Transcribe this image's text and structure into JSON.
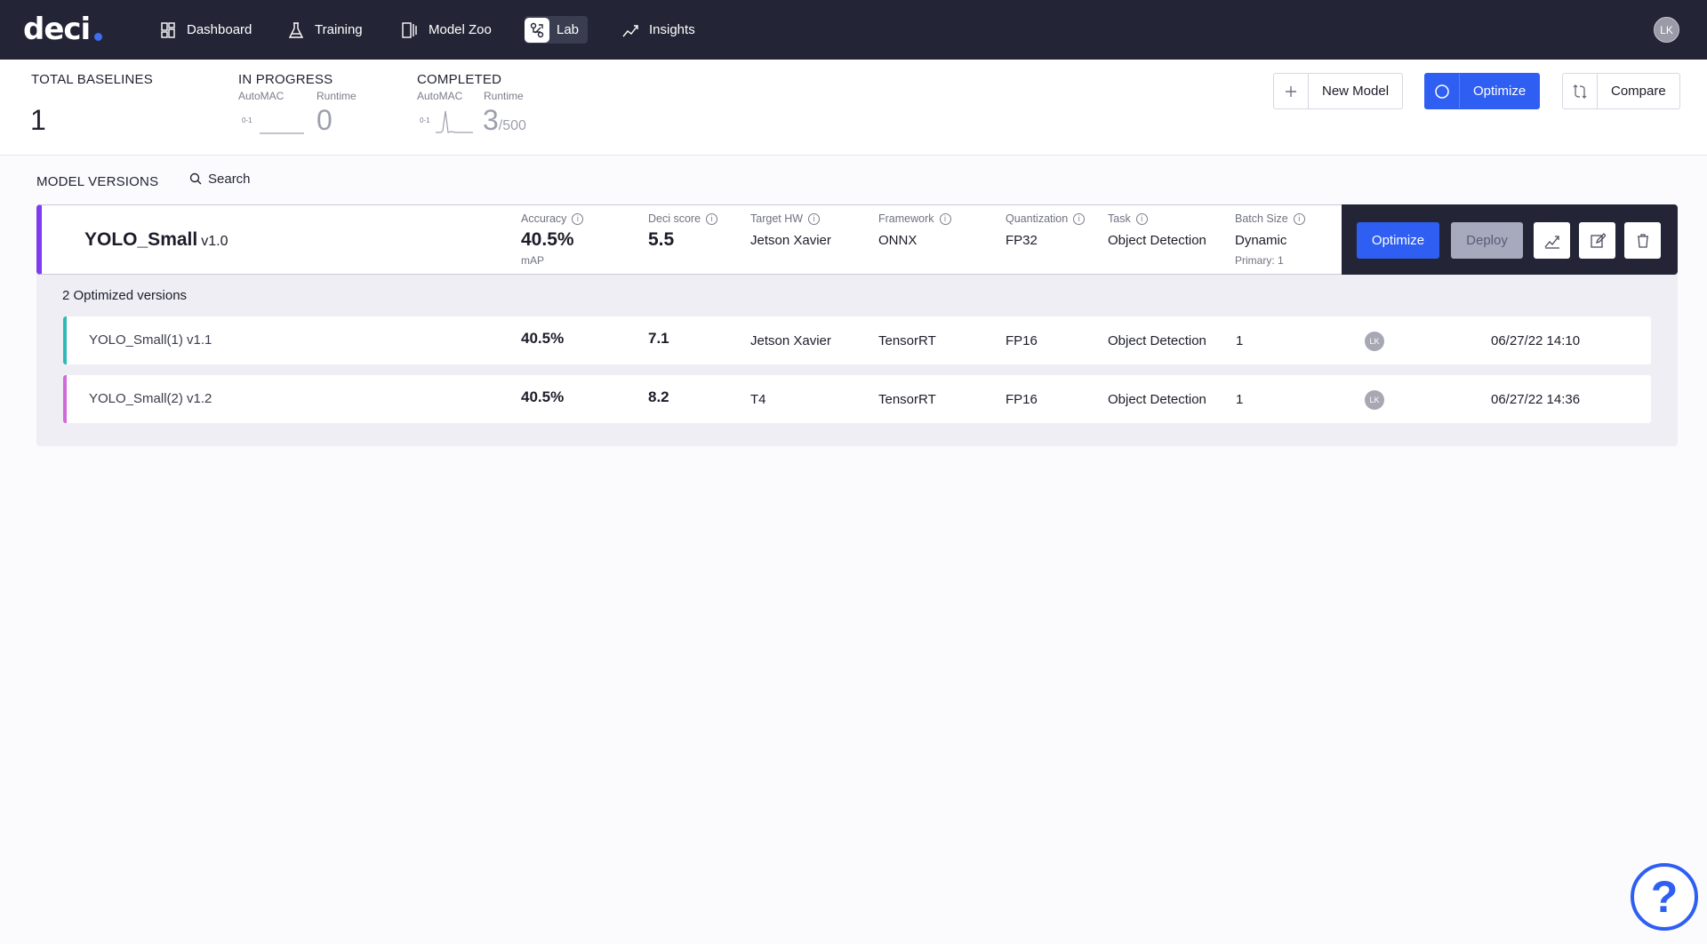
{
  "nav": {
    "logo": "deci",
    "items": [
      {
        "label": "Dashboard",
        "icon": "dashboard-icon"
      },
      {
        "label": "Training",
        "icon": "flask-icon"
      },
      {
        "label": "Model Zoo",
        "icon": "model-zoo-icon"
      },
      {
        "label": "Lab",
        "icon": "lab-icon"
      },
      {
        "label": "Insights",
        "icon": "insights-icon"
      }
    ],
    "active": "Lab",
    "avatar": "LK"
  },
  "stats": {
    "total_baselines": {
      "title": "TOTAL BASELINES",
      "value": "1"
    },
    "in_progress": {
      "title": "IN PROGRESS",
      "automac_label": "AutoMAC",
      "runtime_label": "Runtime",
      "spark_label": "0-1",
      "runtime_value": "0"
    },
    "completed": {
      "title": "COMPLETED",
      "automac_label": "AutoMAC",
      "runtime_label": "Runtime",
      "spark_label": "0-1",
      "runtime_value": "3",
      "runtime_total": "/500"
    }
  },
  "actions": {
    "new_model": "New Model",
    "optimize": "Optimize",
    "compare": "Compare"
  },
  "model_versions": {
    "title": "MODEL VERSIONS",
    "search": "Search"
  },
  "baseline": {
    "name": "YOLO_Small",
    "version": "v1.0",
    "columns": {
      "accuracy": "Accuracy",
      "deci_score": "Deci score",
      "target_hw": "Target HW",
      "framework": "Framework",
      "quantization": "Quantization",
      "task": "Task",
      "batch_size": "Batch Size"
    },
    "accuracy": "40.5%",
    "accuracy_metric": "mAP",
    "deci_score": "5.5",
    "target_hw": "Jetson Xavier",
    "framework": "ONNX",
    "quantization": "FP32",
    "task": "Object Detection",
    "batch_size": "Dynamic",
    "batch_primary": "Primary: 1",
    "optimize_label": "Optimize",
    "deploy_label": "Deploy"
  },
  "optimized": {
    "count_label": "2 Optimized versions",
    "rows": [
      {
        "name": "YOLO_Small(1) v1.1",
        "accuracy": "40.5%",
        "deci_score": "7.1",
        "target_hw": "Jetson Xavier",
        "framework": "TensorRT",
        "quantization": "FP16",
        "task": "Object Detection",
        "batch": "1",
        "avatar": "LK",
        "date": "06/27/22 14:10",
        "color": "#2fb8b8"
      },
      {
        "name": "YOLO_Small(2) v1.2",
        "accuracy": "40.5%",
        "deci_score": "8.2",
        "target_hw": "T4",
        "framework": "TensorRT",
        "quantization": "FP16",
        "task": "Object Detection",
        "batch": "1",
        "avatar": "LK",
        "date": "06/27/22 14:36",
        "color": "#d06ad8"
      }
    ]
  },
  "help": "?"
}
